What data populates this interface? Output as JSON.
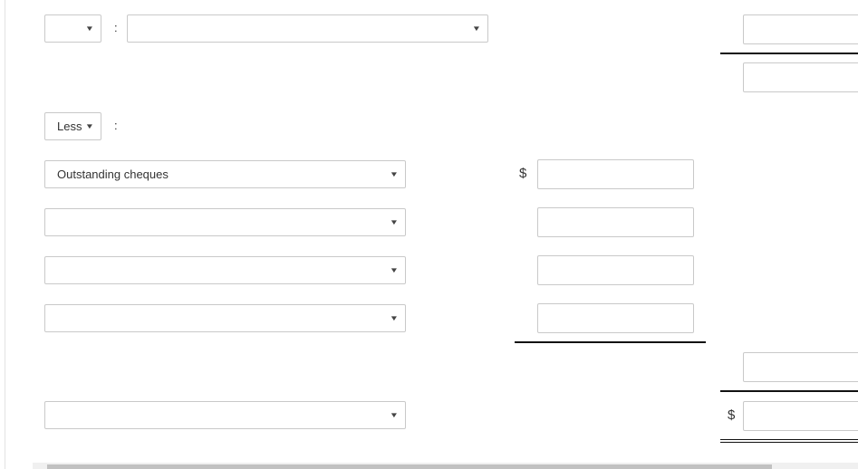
{
  "row1": {
    "type_value": "",
    "account_value": ""
  },
  "less": {
    "value": "Less",
    "colon": ":"
  },
  "colon": ":",
  "items": [
    {
      "label": "Outstanding cheques"
    },
    {
      "label": ""
    },
    {
      "label": ""
    },
    {
      "label": ""
    }
  ],
  "final_select": "",
  "currency": "$",
  "chevron": "⌄"
}
